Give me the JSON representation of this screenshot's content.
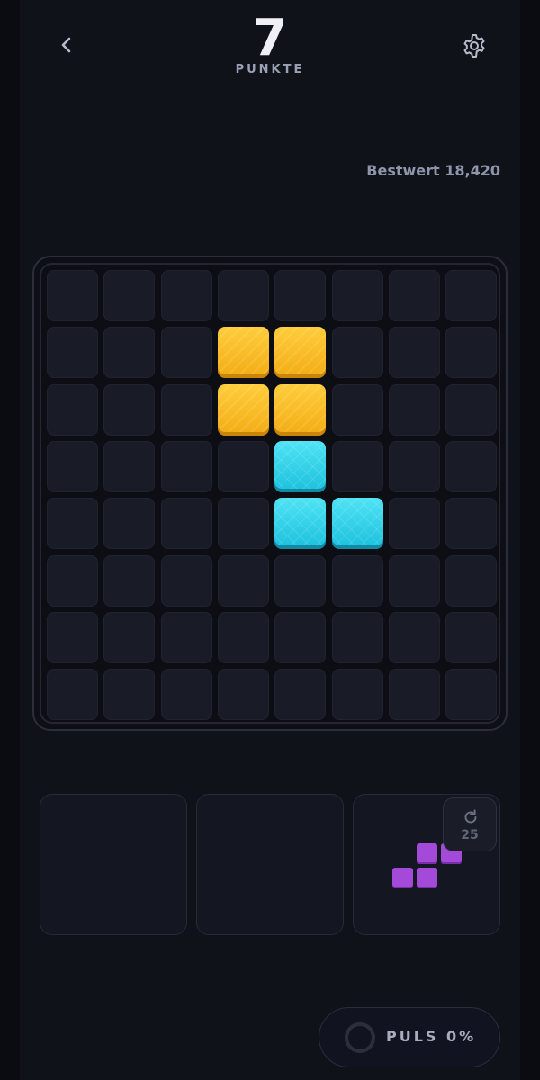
{
  "header": {
    "score": "7",
    "score_label": "PUNKTE",
    "best": "Bestwert 18,420"
  },
  "board": {
    "rows": 8,
    "cols": 8,
    "filled": [
      {
        "row": 1,
        "col": 3,
        "color": "yellow"
      },
      {
        "row": 1,
        "col": 4,
        "color": "yellow"
      },
      {
        "row": 2,
        "col": 3,
        "color": "yellow"
      },
      {
        "row": 2,
        "col": 4,
        "color": "yellow"
      },
      {
        "row": 3,
        "col": 4,
        "color": "cyan"
      },
      {
        "row": 4,
        "col": 4,
        "color": "cyan"
      },
      {
        "row": 4,
        "col": 5,
        "color": "cyan"
      }
    ]
  },
  "tray": {
    "slots": [
      {
        "piece": null
      },
      {
        "piece": null
      },
      {
        "piece": "S",
        "color": "#a44ad9"
      }
    ],
    "rotations_left": "25"
  },
  "pulse": {
    "label": "PULS 0%",
    "percent": 0
  },
  "icons": {
    "back": "chevron-left-icon",
    "settings": "gear-icon",
    "rotate": "rotate-icon"
  },
  "colors": {
    "yellow": "#f7be24",
    "cyan": "#35d6ec",
    "purple": "#a44ad9",
    "background": "#101219"
  }
}
